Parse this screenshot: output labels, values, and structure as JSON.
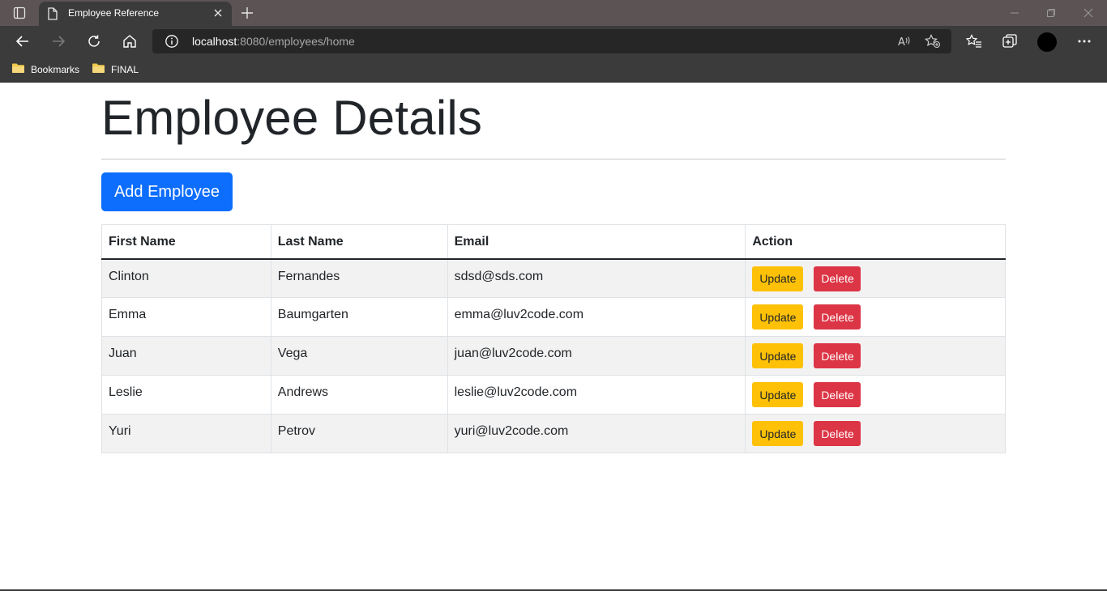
{
  "browser": {
    "tab_title": "Employee Reference",
    "url_host": "localhost",
    "url_rest": ":8080/employees/home",
    "bookmarks": [
      {
        "label": "Bookmarks",
        "icon": "folder-icon"
      },
      {
        "label": "FINAL",
        "icon": "folder-icon"
      }
    ]
  },
  "page": {
    "title": "Employee Details",
    "add_button": "Add Employee",
    "columns": [
      "First Name",
      "Last Name",
      "Email",
      "Action"
    ],
    "rows": [
      {
        "first": "Clinton",
        "last": "Fernandes",
        "email": "sdsd@sds.com"
      },
      {
        "first": "Emma",
        "last": "Baumgarten",
        "email": "emma@luv2code.com"
      },
      {
        "first": "Juan",
        "last": "Vega",
        "email": "juan@luv2code.com"
      },
      {
        "first": "Leslie",
        "last": "Andrews",
        "email": "leslie@luv2code.com"
      },
      {
        "first": "Yuri",
        "last": "Petrov",
        "email": "yuri@luv2code.com"
      }
    ],
    "update_label": "Update",
    "delete_label": "Delete"
  },
  "colors": {
    "primary": "#0d6efd",
    "warning": "#ffc107",
    "danger": "#dc3545"
  }
}
